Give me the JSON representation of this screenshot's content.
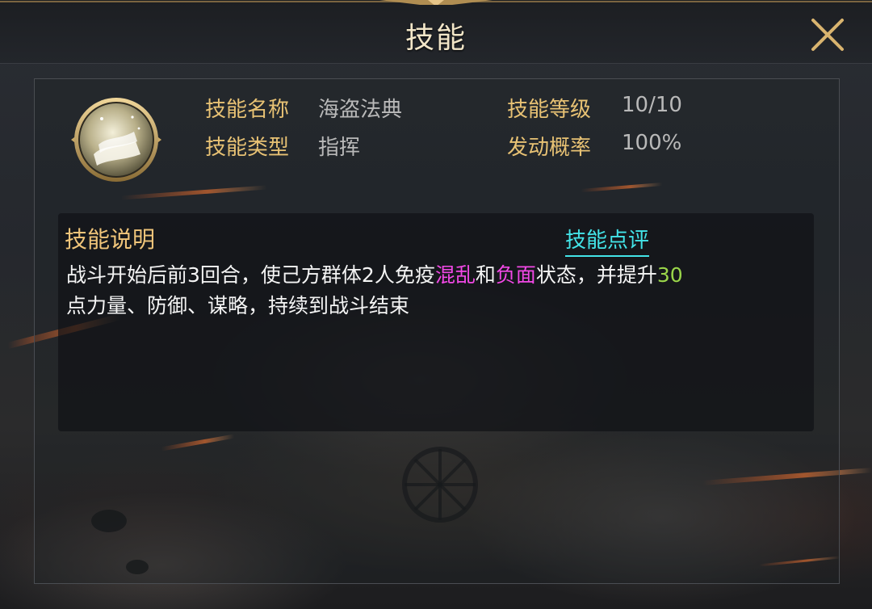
{
  "window": {
    "title": "技能"
  },
  "skill": {
    "icon": "open-book-icon",
    "name_label": "技能名称",
    "name_value": "海盗法典",
    "type_label": "技能类型",
    "type_value": "指挥",
    "level_label": "技能等级",
    "level_value": "10/10",
    "rate_label": "发动概率",
    "rate_value": "100%"
  },
  "description": {
    "heading": "技能说明",
    "review_link": "技能点评",
    "segments": [
      {
        "text": "战斗开始后前3回合，使己方群体2人免疫",
        "color": "#f4f4f4"
      },
      {
        "text": "混乱",
        "color": "#f248e6"
      },
      {
        "text": "和",
        "color": "#f4f4f4"
      },
      {
        "text": "负面",
        "color": "#f248e6"
      },
      {
        "text": "状态，并提升",
        "color": "#f4f4f4"
      },
      {
        "text": "30",
        "color": "#9ad64a"
      },
      {
        "text": "点力量、防御、谋略，持续到战斗结束",
        "color": "#f4f4f4"
      }
    ]
  },
  "colors": {
    "label_gold": "#e8c274",
    "value_gray": "#b9b9b9",
    "link_cyan": "#43e4e8",
    "highlight_pink": "#f248e6",
    "highlight_green": "#9ad64a"
  }
}
